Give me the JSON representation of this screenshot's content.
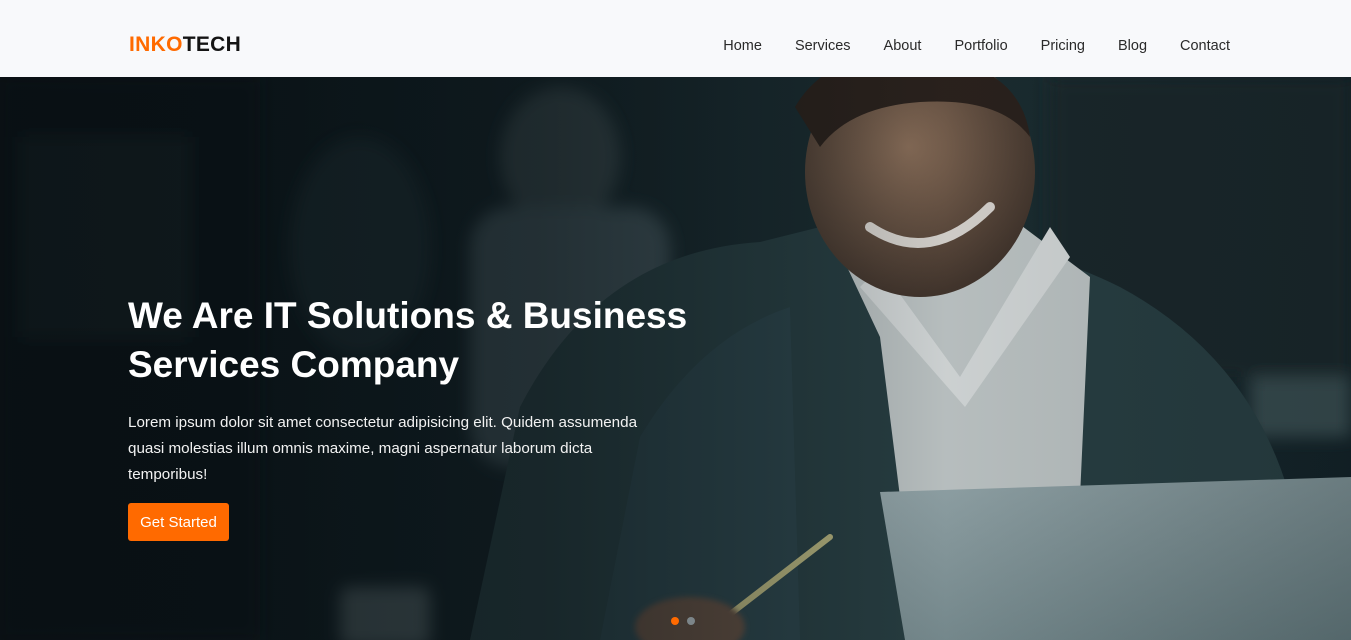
{
  "brand": {
    "part1": "INKO",
    "part2": "TECH",
    "accent_color": "#ff6a00"
  },
  "nav": {
    "items": [
      {
        "label": "Home"
      },
      {
        "label": "Services"
      },
      {
        "label": "About"
      },
      {
        "label": "Portfolio"
      },
      {
        "label": "Pricing"
      },
      {
        "label": "Blog"
      },
      {
        "label": "Contact"
      }
    ]
  },
  "hero": {
    "title": "We Are IT Solutions & Business Services Company",
    "description": "Lorem ipsum dolor sit amet consectetur adipisicing elit. Quidem assumenda quasi molestias illum omnis maxime, magni aspernatur laborum dicta temporibus!",
    "cta_label": "Get Started",
    "background_image": "smiling-man-at-laptop-photo",
    "slider": {
      "slide_count": 2,
      "active_index": 0
    }
  }
}
